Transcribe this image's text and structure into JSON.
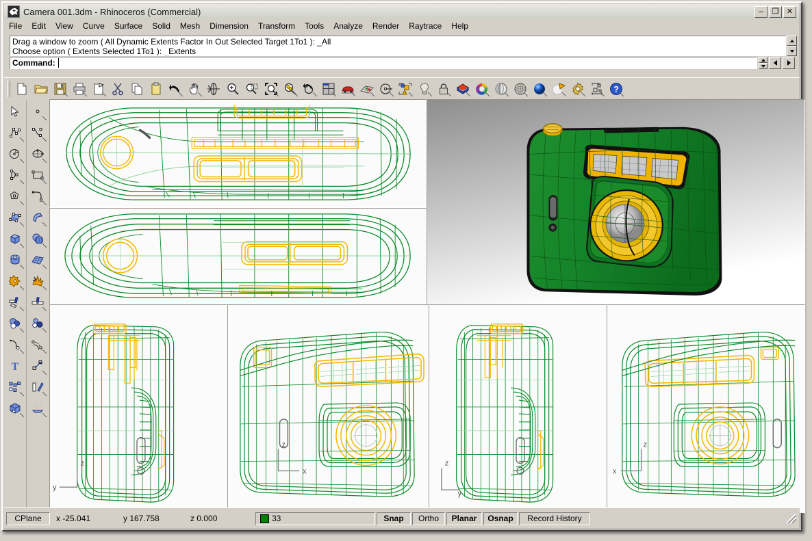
{
  "window": {
    "title": "Camera 001.3dm - Rhinoceros (Commercial)",
    "app_icon": "rhino-icon",
    "minimize_label": "–",
    "maximize_label": "❐",
    "close_label": "✕"
  },
  "menubar": {
    "items": [
      {
        "label": "File",
        "name": "menu-file"
      },
      {
        "label": "Edit",
        "name": "menu-edit"
      },
      {
        "label": "View",
        "name": "menu-view"
      },
      {
        "label": "Curve",
        "name": "menu-curve"
      },
      {
        "label": "Surface",
        "name": "menu-surface"
      },
      {
        "label": "Solid",
        "name": "menu-solid"
      },
      {
        "label": "Mesh",
        "name": "menu-mesh"
      },
      {
        "label": "Dimension",
        "name": "menu-dimension"
      },
      {
        "label": "Transform",
        "name": "menu-transform"
      },
      {
        "label": "Tools",
        "name": "menu-tools"
      },
      {
        "label": "Analyze",
        "name": "menu-analyze"
      },
      {
        "label": "Render",
        "name": "menu-render"
      },
      {
        "label": "Raytrace",
        "name": "menu-raytrace"
      },
      {
        "label": "Help",
        "name": "menu-help"
      }
    ]
  },
  "command_area": {
    "history": [
      "Drag a window to zoom ( All  Dynamic  Extents  Factor  In  Out  Selected  Target  1To1 ): _All",
      "Choose option ( Extents  Selected  1To1 ): _Extents"
    ],
    "prompt_label": "Command:",
    "input_value": "",
    "input_placeholder": ""
  },
  "toolbar": {
    "buttons": [
      {
        "name": "new-file-button",
        "icon": "new-document-icon",
        "tooltip": "New"
      },
      {
        "name": "open-file-button",
        "icon": "open-folder-icon",
        "tooltip": "Open"
      },
      {
        "name": "save-file-button",
        "icon": "save-disk-icon",
        "tooltip": "Save"
      },
      {
        "name": "print-button",
        "icon": "printer-icon",
        "tooltip": "Print"
      },
      {
        "name": "properties-button",
        "icon": "page-properties-icon",
        "tooltip": "Properties"
      },
      {
        "name": "cut-button",
        "icon": "scissors-icon",
        "tooltip": "Cut"
      },
      {
        "name": "copy-button",
        "icon": "copy-pages-icon",
        "tooltip": "Copy"
      },
      {
        "name": "paste-button",
        "icon": "clipboard-icon",
        "tooltip": "Paste"
      },
      {
        "name": "undo-button",
        "icon": "undo-arrow-icon",
        "tooltip": "Undo"
      },
      {
        "name": "pan-button",
        "icon": "hand-pan-icon",
        "tooltip": "Pan"
      },
      {
        "name": "rotate-view-button",
        "icon": "orbit-icon",
        "tooltip": "Rotate view"
      },
      {
        "name": "zoom-in-button",
        "icon": "magnifier-plus-icon",
        "tooltip": "Zoom in"
      },
      {
        "name": "zoom-window-button",
        "icon": "magnifier-window-icon",
        "tooltip": "Zoom window"
      },
      {
        "name": "zoom-extents-button",
        "icon": "zoom-extents-icon",
        "tooltip": "Zoom extents"
      },
      {
        "name": "zoom-selected-button",
        "icon": "magnifier-selected-icon",
        "tooltip": "Zoom selected"
      },
      {
        "name": "undo-view-button",
        "icon": "undo-view-icon",
        "tooltip": "Undo view change"
      },
      {
        "name": "viewport-layout-button",
        "icon": "four-viewport-icon",
        "tooltip": "Viewport layout"
      },
      {
        "name": "named-views-button",
        "icon": "car-icon",
        "tooltip": "Named views"
      },
      {
        "name": "surface-tools-button",
        "icon": "grid-surface-icon",
        "tooltip": "Surface tools"
      },
      {
        "name": "circle-button",
        "icon": "circle-center-icon",
        "tooltip": "Circle"
      },
      {
        "name": "object-props-button",
        "icon": "object-properties-icon",
        "tooltip": "Object properties"
      },
      {
        "name": "light-button",
        "icon": "lightbulb-icon",
        "tooltip": "Lights"
      },
      {
        "name": "lock-button",
        "icon": "padlock-icon",
        "tooltip": "Lock"
      },
      {
        "name": "layers-button",
        "icon": "layers-icon",
        "tooltip": "Layers"
      },
      {
        "name": "color-wheel-button",
        "icon": "color-wheel-icon",
        "tooltip": "Color"
      },
      {
        "name": "shade-button",
        "icon": "shaded-sphere-icon",
        "tooltip": "Shade"
      },
      {
        "name": "wireframe-button",
        "icon": "wireframe-sphere-icon",
        "tooltip": "Wireframe"
      },
      {
        "name": "render-button",
        "icon": "render-sphere-icon",
        "tooltip": "Render"
      },
      {
        "name": "render-preview-button",
        "icon": "render-preview-icon",
        "tooltip": "Render preview"
      },
      {
        "name": "options-button",
        "icon": "gear-icon",
        "tooltip": "Options"
      },
      {
        "name": "dimension-button",
        "icon": "dimension-icon",
        "tooltip": "Dimension"
      },
      {
        "name": "help-button",
        "icon": "help-question-icon",
        "tooltip": "Help"
      }
    ]
  },
  "sidebar": {
    "left_column": [
      {
        "name": "select-tool",
        "icon": "arrow-cursor-icon"
      },
      {
        "name": "polyline-tool",
        "icon": "polyline-icon"
      },
      {
        "name": "circle-tool",
        "icon": "circle-icon"
      },
      {
        "name": "arc-tool",
        "icon": "arc-icon"
      },
      {
        "name": "polygon-tool",
        "icon": "polygon-icon"
      },
      {
        "name": "surface-from-curves-tool",
        "icon": "control-point-surface-icon"
      },
      {
        "name": "box-tool",
        "icon": "box-icon"
      },
      {
        "name": "cylinder-tool",
        "icon": "cylinder-icon"
      },
      {
        "name": "boolean-union-tool",
        "icon": "boolean-union-icon"
      },
      {
        "name": "trim-tool",
        "icon": "trim-icon"
      },
      {
        "name": "mesh-from-surface-tool",
        "icon": "mesh-sphere-icon"
      },
      {
        "name": "fillet-curve-tool",
        "icon": "fillet-curve-icon"
      },
      {
        "name": "text-tool",
        "icon": "text-icon"
      },
      {
        "name": "array-tool",
        "icon": "array-icon"
      },
      {
        "name": "render-solid-tool",
        "icon": "solid-render-icon"
      }
    ],
    "right_column": [
      {
        "name": "point-tool",
        "icon": "point-icon"
      },
      {
        "name": "curve-tool",
        "icon": "interpolated-curve-icon"
      },
      {
        "name": "ellipse-tool",
        "icon": "ellipse-icon"
      },
      {
        "name": "rectangle-tool",
        "icon": "rectangle-icon"
      },
      {
        "name": "curve-fillet-tool",
        "icon": "corner-fillet-icon"
      },
      {
        "name": "extrude-surface-tool",
        "icon": "extrude-surface-icon"
      },
      {
        "name": "sphere-tool",
        "icon": "sphere-icon"
      },
      {
        "name": "surface-grid-tool",
        "icon": "surface-grid-icon"
      },
      {
        "name": "explode-tool",
        "icon": "explode-icon"
      },
      {
        "name": "split-tool",
        "icon": "split-icon"
      },
      {
        "name": "mesh-points-tool",
        "icon": "mesh-points-icon"
      },
      {
        "name": "offset-curve-tool",
        "icon": "offset-curve-icon"
      },
      {
        "name": "scale-tool",
        "icon": "scale-arrow-icon"
      },
      {
        "name": "mirror-tool",
        "icon": "mirror-icon"
      },
      {
        "name": "lighting-tool",
        "icon": "spotlight-array-icon"
      }
    ]
  },
  "viewports": [
    {
      "name": "viewport-top",
      "axes": [],
      "shading": "wireframe"
    },
    {
      "name": "viewport-perspective",
      "axes": [],
      "shading": "shaded"
    },
    {
      "name": "viewport-bottom",
      "axes": [],
      "shading": "wireframe"
    },
    {
      "name": "viewport-right",
      "axes": [
        "y",
        "z"
      ],
      "shading": "wireframe"
    },
    {
      "name": "viewport-front",
      "axes": [
        "z",
        "x"
      ],
      "shading": "wireframe"
    },
    {
      "name": "viewport-left",
      "axes": [
        "z",
        "y"
      ],
      "shading": "wireframe"
    },
    {
      "name": "viewport-back",
      "axes": [
        "z",
        "x"
      ],
      "shading": "wireframe"
    }
  ],
  "axis_labels": {
    "x": "x",
    "y": "y",
    "z": "z"
  },
  "statusbar": {
    "cplane_label": "CPlane",
    "x_label": "x -25.041",
    "y_label": "y 167.758",
    "z_label": "z 0.000",
    "layer_name": "33",
    "layer_color": "#008000",
    "toggles": [
      {
        "label": "Snap",
        "name": "status-snap",
        "bold": true
      },
      {
        "label": "Ortho",
        "name": "status-ortho",
        "bold": false
      },
      {
        "label": "Planar",
        "name": "status-planar",
        "bold": true
      },
      {
        "label": "Osnap",
        "name": "status-osnap",
        "bold": true
      }
    ],
    "record_history_label": "Record History"
  },
  "colors": {
    "model_green": "#0a8a28",
    "model_yellow": "#f5b800",
    "shaded_green": "#1a8a2a",
    "shaded_green_dark": "#0d6b1e",
    "chrome": "#d4d0c8",
    "viewport_bg": "#fbfbfb"
  }
}
